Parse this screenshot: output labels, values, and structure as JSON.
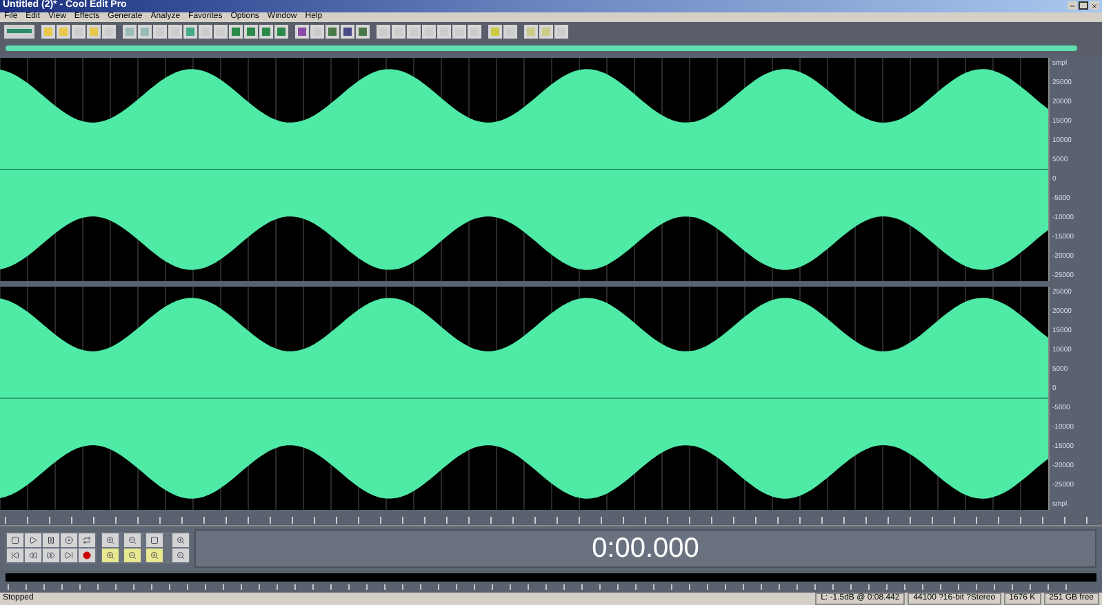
{
  "window": {
    "title": "Untitled (2)* - Cool Edit Pro"
  },
  "menu": [
    "File",
    "Edit",
    "View",
    "Effects",
    "Generate",
    "Analyze",
    "Favorites",
    "Options",
    "Window",
    "Help"
  ],
  "amplitude_ruler": [
    {
      "labels": [
        "smpl",
        "25000",
        "20000",
        "15000",
        "10000",
        "5000",
        "0",
        "-5000",
        "-10000",
        "-15000",
        "-20000",
        "-25000"
      ]
    },
    {
      "labels": [
        "25000",
        "20000",
        "15000",
        "10000",
        "5000",
        "0",
        "-5000",
        "-10000",
        "-15000",
        "-20000",
        "-25000",
        "smpl"
      ]
    }
  ],
  "time_display": "0:00.000",
  "status_bar": {
    "state": "Stopped",
    "fields": [
      "L: -1.5dB @ 0:08.442",
      "44100 ?16-bit ?Stereo",
      "1676 K",
      "251 GB free"
    ]
  }
}
